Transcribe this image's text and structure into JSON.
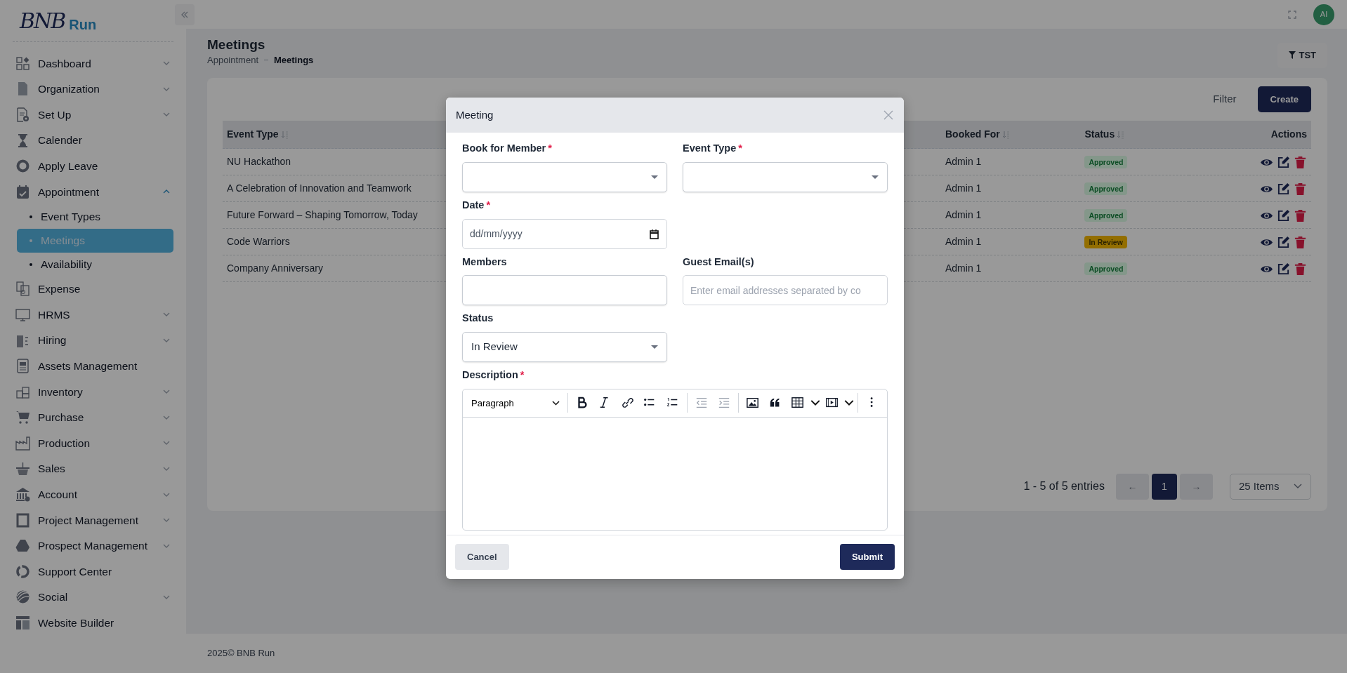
{
  "topbar": {
    "avatar": "AI"
  },
  "sidebar": {
    "logo": {
      "mark": "BNB",
      "text": "Run"
    },
    "items": [
      {
        "label": "Dashboard",
        "expandable": true,
        "expanded": false
      },
      {
        "label": "Organization",
        "expandable": true,
        "expanded": false
      },
      {
        "label": "Set Up",
        "expandable": true,
        "expanded": false
      },
      {
        "label": "Calender",
        "expandable": false
      },
      {
        "label": "Apply Leave",
        "expandable": false
      },
      {
        "label": "Appointment",
        "expandable": true,
        "expanded": true,
        "children": [
          {
            "label": "Event Types",
            "selected": false
          },
          {
            "label": "Meetings",
            "selected": true
          },
          {
            "label": "Availability",
            "selected": false
          }
        ]
      },
      {
        "label": "Expense",
        "expandable": false
      },
      {
        "label": "HRMS",
        "expandable": true,
        "expanded": false
      },
      {
        "label": "Hiring",
        "expandable": true,
        "expanded": false
      },
      {
        "label": "Assets Management",
        "expandable": false
      },
      {
        "label": "Inventory",
        "expandable": true,
        "expanded": false
      },
      {
        "label": "Purchase",
        "expandable": true,
        "expanded": false
      },
      {
        "label": "Production",
        "expandable": true,
        "expanded": false
      },
      {
        "label": "Sales",
        "expandable": true,
        "expanded": false
      },
      {
        "label": "Account",
        "expandable": true,
        "expanded": false
      },
      {
        "label": "Project Management",
        "expandable": true,
        "expanded": false
      },
      {
        "label": "Prospect Management",
        "expandable": true,
        "expanded": false
      },
      {
        "label": "Support Center",
        "expandable": false
      },
      {
        "label": "Social",
        "expandable": true,
        "expanded": false
      },
      {
        "label": "Website Builder",
        "expandable": false
      }
    ]
  },
  "page": {
    "title": "Meetings",
    "breadcrumb": [
      "Appointment",
      "Meetings"
    ],
    "filter_chip": "TST",
    "filter_link": "Filter",
    "create_button": "Create"
  },
  "table": {
    "columns": [
      {
        "label": "Event Type",
        "sortable": true
      },
      {
        "label": "Booked For",
        "sortable": true
      },
      {
        "label": "Status",
        "sortable": true
      },
      {
        "label": "Actions",
        "sortable": false
      }
    ],
    "rows": [
      {
        "event_type": "NU Hackathon",
        "booked_for": "Admin 1",
        "status": {
          "label": "Approved",
          "kind": "approved"
        }
      },
      {
        "event_type": "A Celebration of Innovation and Teamwork",
        "booked_for": "Admin 1",
        "status": {
          "label": "Approved",
          "kind": "approved"
        }
      },
      {
        "event_type": "Future Forward – Shaping Tomorrow, Today",
        "booked_for": "Admin 1",
        "status": {
          "label": "Approved",
          "kind": "approved"
        }
      },
      {
        "event_type": "Code Warriors",
        "booked_for": "Admin 1",
        "status": {
          "label": "In Review",
          "kind": "review"
        }
      },
      {
        "event_type": "Company Anniversary",
        "booked_for": "Admin 1",
        "status": {
          "label": "Approved",
          "kind": "approved"
        }
      }
    ]
  },
  "pagination": {
    "summary": "1 - 5 of 5 entries",
    "prev": {
      "label": "←",
      "disabled": true
    },
    "pages": [
      {
        "label": "1",
        "selected": true
      }
    ],
    "next": {
      "label": "→",
      "disabled": true
    },
    "page_size": "25 Items"
  },
  "footer": "2025© BNB Run",
  "modal": {
    "title": "Meeting",
    "form_rows": [
      [
        {
          "label": "Book for Member",
          "required_mark": "*",
          "kind": "select"
        },
        {
          "label": "Event Type",
          "required_mark": "*",
          "kind": "select"
        }
      ],
      [
        {
          "label": "Date",
          "required_mark": "*",
          "kind": "date",
          "placeholder": "dd/mm/yyyy"
        }
      ],
      [
        {
          "label": "Members",
          "kind": "text"
        },
        {
          "label": "Guest Email(s)",
          "kind": "text",
          "placeholder": "Enter email addresses separated by co"
        }
      ],
      [
        {
          "label": "Status",
          "kind": "select",
          "value": "In Review"
        }
      ]
    ],
    "description": {
      "label": "Description",
      "required_mark": "*",
      "block_style": "Paragraph"
    },
    "cancel": "Cancel",
    "submit": "Submit"
  }
}
